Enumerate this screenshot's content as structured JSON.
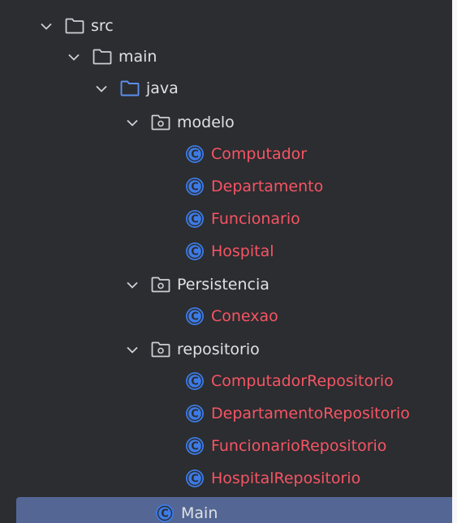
{
  "colors": {
    "panel_background": "#2b2d30",
    "selection": "#546694",
    "default_text": "#dfe1e5",
    "modified_class_text": "#f75464",
    "class_icon": "#3d7be6",
    "source_folder_icon": "#5b8eed",
    "folder_icon": "#ced0d6"
  },
  "tree": {
    "src": {
      "label": "src",
      "icon": "folder-icon",
      "expanded": true
    },
    "main": {
      "label": "main",
      "icon": "folder-icon",
      "expanded": true
    },
    "java": {
      "label": "java",
      "icon": "source-folder-icon",
      "expanded": true
    },
    "modelo": {
      "label": "modelo",
      "icon": "package-icon",
      "expanded": true,
      "classes": [
        "Computador",
        "Departamento",
        "Funcionario",
        "Hospital"
      ]
    },
    "persistencia": {
      "label": "Persistencia",
      "icon": "package-icon",
      "expanded": true,
      "classes": [
        "Conexao"
      ]
    },
    "repositorio": {
      "label": "repositorio",
      "icon": "package-icon",
      "expanded": true,
      "classes": [
        "ComputadorRepositorio",
        "DepartamentoRepositorio",
        "FuncionarioRepositorio",
        "HospitalRepositorio"
      ]
    },
    "main_class": {
      "label": "Main",
      "icon": "class-icon",
      "selected": true
    }
  }
}
